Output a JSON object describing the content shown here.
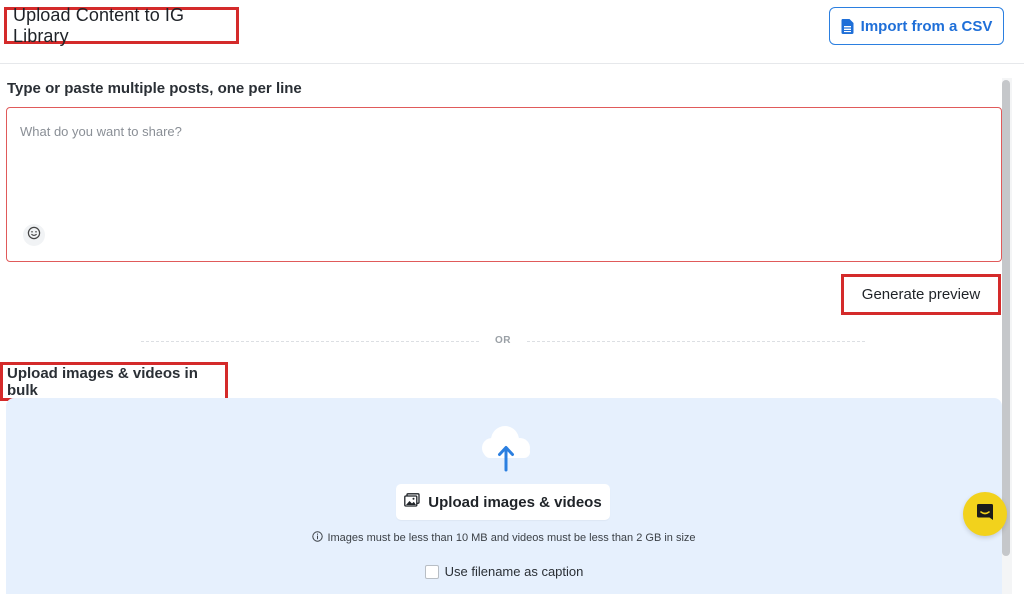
{
  "header": {
    "title": "Upload Content to IG Library",
    "import_csv_label": "Import from a CSV"
  },
  "posts": {
    "section_label": "Type or paste multiple posts, one per line",
    "placeholder": "What do you want to share?",
    "generate_preview_label": "Generate preview"
  },
  "divider": {
    "or_label": "OR"
  },
  "bulk": {
    "section_label": "Upload images & videos in bulk",
    "upload_button_label": "Upload images & videos",
    "size_note": "Images must be less than 10 MB and videos must be less than 2 GB in size",
    "filename_caption_label": "Use filename as caption"
  },
  "colors": {
    "highlight_red": "#d42a2a",
    "primary_blue": "#1f6fd8",
    "dropzone_bg": "#e6f0fd",
    "chat_yellow": "#f2d21c"
  },
  "icons": {
    "csv": "sheet-icon",
    "emoji": "emoji-icon",
    "cloud_upload": "cloud-upload-icon",
    "image": "image-icon",
    "info": "info-icon",
    "chat": "chat-icon"
  }
}
